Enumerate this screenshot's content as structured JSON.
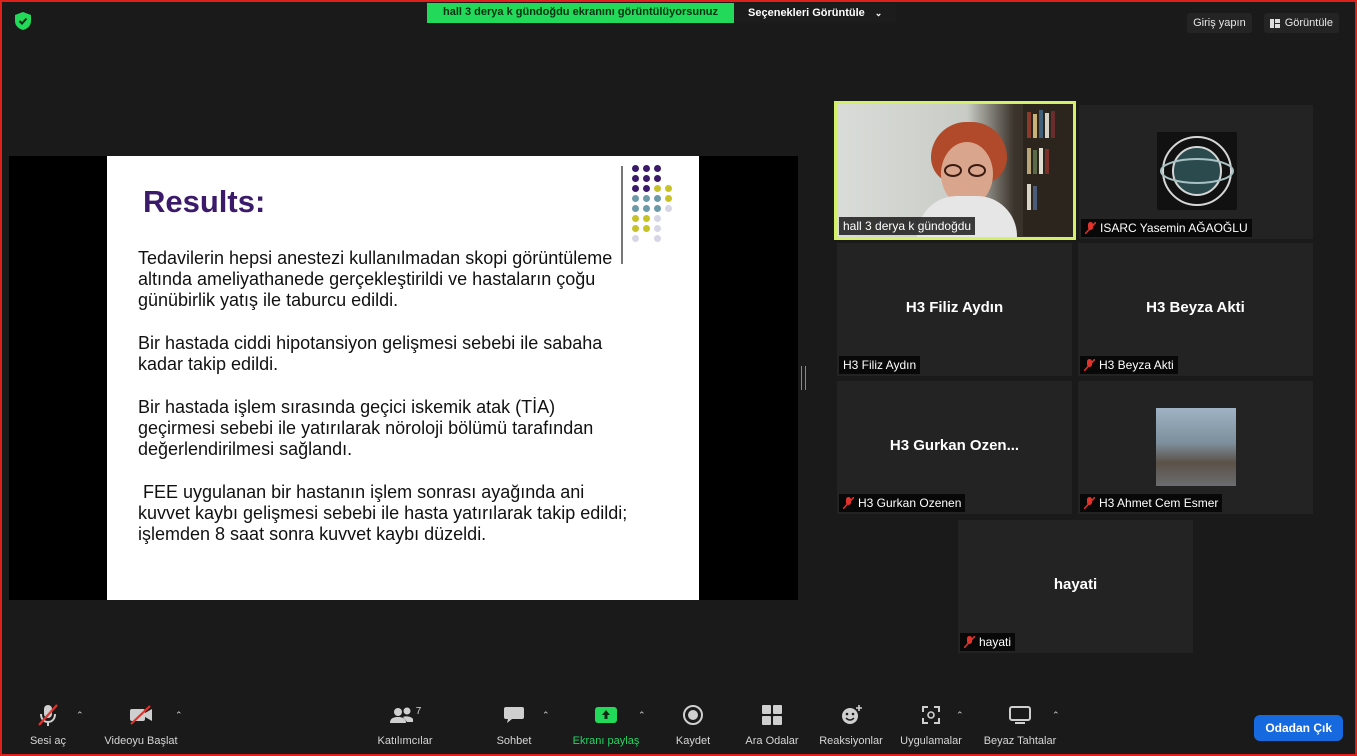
{
  "top_bar": {
    "share_notice": "hall 3 derya k gündoğdu ekranını görüntülüyorsunuz",
    "view_options": "Seçenekleri Görüntüle",
    "sign_in": "Giriş yapın",
    "view": "Görüntüle"
  },
  "slide": {
    "title": "Results:",
    "paragraphs": [
      "Tedavilerin hepsi anestezi kullanılmadan skopi görüntüleme altında ameliyathanede gerçekleştirildi ve hastaların çoğu günübirlik yatış ile taburcu edildi.",
      "Bir hastada ciddi hipotansiyon gelişmesi sebebi ile sabaha kadar takip edildi.",
      "Bir hastada işlem sırasında geçici iskemik atak (TİA) geçirmesi sebebi ile yatırılarak nöroloji bölümü tarafından değerlendirilmesi sağlandı.",
      " FEE uygulanan bir hastanın işlem sonrası ayağında ani kuvvet kaybı gelişmesi sebebi ile hasta yatırılarak takip edildi; işlemden 8 saat sonra kuvvet kaybı düzeldi."
    ]
  },
  "participants": [
    {
      "label": "hall 3 derya k gündoğdu",
      "big_name": "",
      "muted": false
    },
    {
      "label": "ISARC Yasemin AĞAOĞLU",
      "big_name": "",
      "muted": true
    },
    {
      "label": "H3 Filiz Aydın",
      "big_name": "H3 Filiz Aydın",
      "muted": false
    },
    {
      "label": "H3 Beyza Akti",
      "big_name": "H3 Beyza Akti",
      "muted": true
    },
    {
      "label": "H3 Gurkan Ozenen",
      "big_name": "H3 Gurkan Ozen...",
      "muted": true
    },
    {
      "label": "H3 Ahmet Cem Esmer",
      "big_name": "",
      "muted": true
    },
    {
      "label": "hayati",
      "big_name": "hayati",
      "muted": true
    }
  ],
  "toolbar": {
    "unmute": "Sesi aç",
    "start_video": "Videoyu Başlat",
    "participants": "Katılımcılar",
    "participants_count": "7",
    "chat": "Sohbet",
    "share_screen": "Ekranı paylaş",
    "record": "Kaydet",
    "breakout": "Ara Odalar",
    "reactions": "Reaksiyonlar",
    "apps": "Uygulamalar",
    "whiteboards": "Beyaz Tahtalar",
    "leave": "Odadan Çık"
  },
  "colors": {
    "accent_green": "#23d959",
    "active_speaker_border": "#d4f06b",
    "slide_title": "#3b1a6b",
    "leave_button": "#1769e0",
    "muted_red": "#e0332b"
  }
}
